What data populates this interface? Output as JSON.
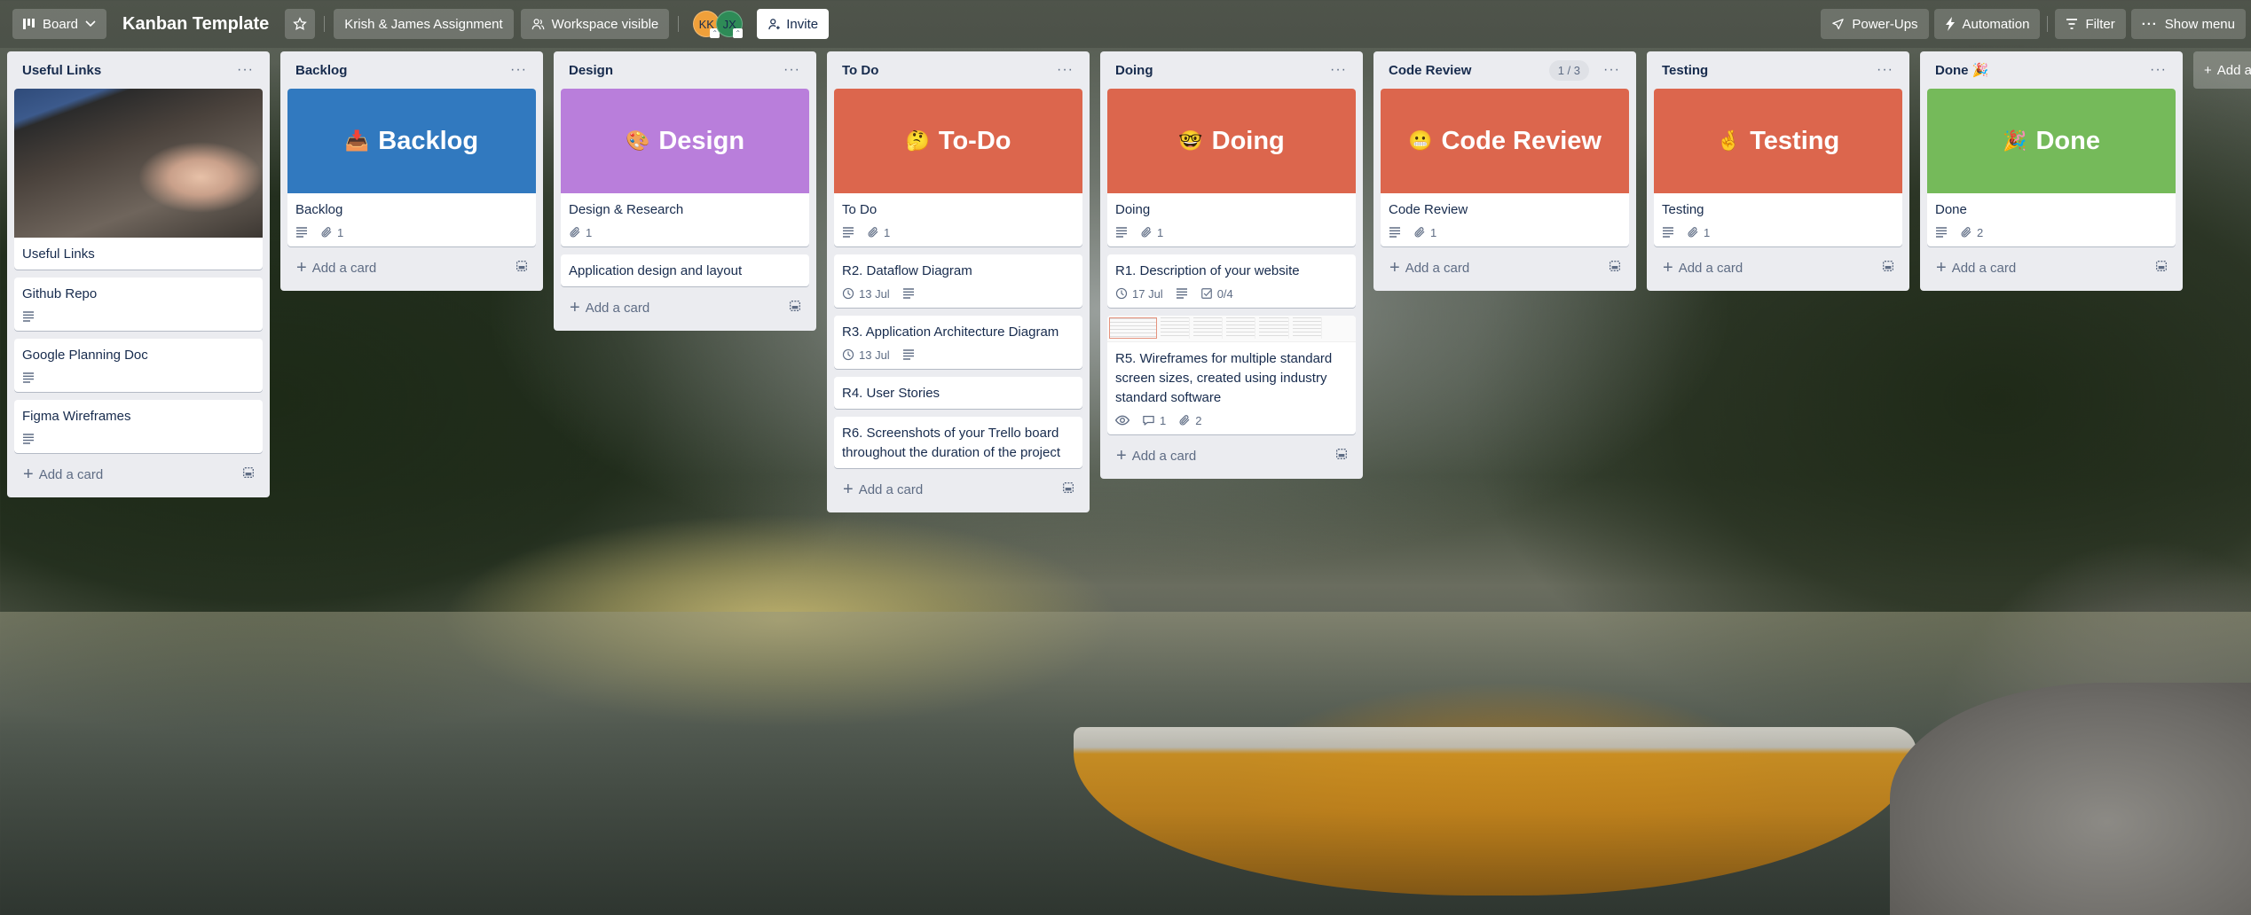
{
  "header": {
    "view_switcher": "Board",
    "board_title": "Kanban Template",
    "workspace_name": "Krish & James Assignment",
    "visibility": "Workspace visible",
    "members": [
      {
        "initials": "KK",
        "color": "#f0a03a"
      },
      {
        "initials": "JX",
        "color": "#2e8b57"
      }
    ],
    "invite_label": "Invite",
    "power_ups_label": "Power-Ups",
    "automation_label": "Automation",
    "filter_label": "Filter",
    "show_menu_label": "Show menu"
  },
  "add_card_label": "Add a card",
  "add_list_label": "Add another list",
  "lists": [
    {
      "title": "Useful Links",
      "cards": [
        {
          "title": "Useful Links",
          "cover": "photo"
        },
        {
          "title": "Github Repo",
          "description": true
        },
        {
          "title": "Google Planning Doc",
          "description": true
        },
        {
          "title": "Figma Wireframes",
          "description": true
        }
      ]
    },
    {
      "title": "Backlog",
      "cards": [
        {
          "title": "Backlog",
          "cover": "color",
          "cover_color": "#3179bf",
          "cover_emoji": "📥",
          "cover_text": "Backlog",
          "description": true,
          "attachments": "1"
        }
      ]
    },
    {
      "title": "Design",
      "cards": [
        {
          "title": "Design & Research",
          "cover": "color",
          "cover_color": "#b97edb",
          "cover_emoji": "🎨",
          "cover_text": "Design",
          "attachments": "1"
        },
        {
          "title": "Application design and layout"
        }
      ]
    },
    {
      "title": "To Do",
      "cards": [
        {
          "title": "To Do",
          "cover": "color",
          "cover_color": "#dc664d",
          "cover_emoji": "🤔",
          "cover_text": "To-Do",
          "description": true,
          "attachments": "1"
        },
        {
          "title": "R2. Dataflow Diagram",
          "due": "13 Jul",
          "description": true
        },
        {
          "title": "R3. Application Architecture Diagram",
          "due": "13 Jul",
          "description": true
        },
        {
          "title": "R4. User Stories"
        },
        {
          "title": "R6. Screenshots of your Trello board throughout the duration of the project"
        }
      ]
    },
    {
      "title": "Doing",
      "cards": [
        {
          "title": "Doing",
          "cover": "color",
          "cover_color": "#dc664d",
          "cover_emoji": "🤓",
          "cover_text": "Doing",
          "description": true,
          "attachments": "1"
        },
        {
          "title": "R1. Description of your website",
          "due": "17 Jul",
          "description": true,
          "checklist": "0/4"
        },
        {
          "title": "R5. Wireframes for multiple standard screen sizes, created using industry standard software",
          "cover": "thumb",
          "watching": true,
          "comments": "1",
          "attachments": "2"
        }
      ]
    },
    {
      "title": "Code Review",
      "count": "1 / 3",
      "cards": [
        {
          "title": "Code Review",
          "cover": "color",
          "cover_color": "#dc664d",
          "cover_emoji": "😬",
          "cover_text": "Code Review",
          "description": true,
          "attachments": "1"
        }
      ]
    },
    {
      "title": "Testing",
      "cards": [
        {
          "title": "Testing",
          "cover": "color",
          "cover_color": "#dc664d",
          "cover_emoji": "🤞",
          "cover_text": "Testing",
          "description": true,
          "attachments": "1"
        }
      ]
    },
    {
      "title": "Done 🎉",
      "cards": [
        {
          "title": "Done",
          "cover": "color",
          "cover_color": "#75ba5a",
          "cover_emoji": "🎉",
          "cover_text": "Done",
          "description": true,
          "attachments": "2"
        }
      ]
    }
  ]
}
